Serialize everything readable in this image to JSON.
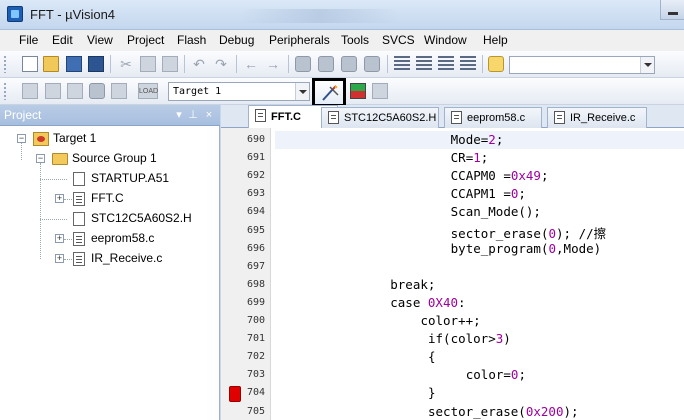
{
  "window": {
    "title": "FFT - µVision4"
  },
  "menu": [
    "File",
    "Edit",
    "View",
    "Project",
    "Flash",
    "Debug",
    "Peripherals",
    "Tools",
    "SVCS",
    "Window",
    "Help"
  ],
  "toolbar": {
    "target_select": "Target 1",
    "options_button_tooltip": "Options for Target..."
  },
  "project": {
    "panel_title": "Project",
    "panel_buttons": [
      "▾",
      "⊥",
      "×"
    ],
    "target": "Target 1",
    "group": "Source Group 1",
    "files": [
      {
        "name": "STARTUP.A51",
        "expandable": false
      },
      {
        "name": "FFT.C",
        "expandable": true
      },
      {
        "name": "STC12C5A60S2.H",
        "expandable": false
      },
      {
        "name": "eeprom58.c",
        "expandable": true
      },
      {
        "name": "IR_Receive.c",
        "expandable": true
      }
    ]
  },
  "tabs": [
    "FFT.C",
    "STC12C5A60S2.H",
    "eeprom58.c",
    "IR_Receive.c"
  ],
  "active_tab": "FFT.C",
  "editor": {
    "lines": [
      {
        "num": "690",
        "indent": 23,
        "pre": "Mode=",
        "lit": "2",
        "post": ";"
      },
      {
        "num": "691",
        "indent": 23,
        "pre": "CR=",
        "lit": "1",
        "post": ";"
      },
      {
        "num": "692",
        "indent": 23,
        "pre": "CCAPM0 =",
        "lit": "0x49",
        "post": ";"
      },
      {
        "num": "693",
        "indent": 23,
        "pre": "CCAPM1 =",
        "lit": "0",
        "post": ";"
      },
      {
        "num": "694",
        "indent": 23,
        "pre": "Scan_Mode();",
        "lit": "",
        "post": ""
      },
      {
        "num": "695",
        "indent": 23,
        "pre": "sector_erase(",
        "lit": "0",
        "post": "); //擦"
      },
      {
        "num": "696",
        "indent": 23,
        "pre": "byte_program(",
        "lit": "0",
        "post": ",Mode)"
      },
      {
        "num": "697",
        "indent": 0,
        "pre": "",
        "lit": "",
        "post": ""
      },
      {
        "num": "698",
        "indent": 15,
        "pre": "break;",
        "lit": "",
        "post": ""
      },
      {
        "num": "699",
        "indent": 15,
        "pre": "case ",
        "lit": "0X40",
        "post": ":"
      },
      {
        "num": "700",
        "indent": 19,
        "pre": "color++;",
        "lit": "",
        "post": ""
      },
      {
        "num": "701",
        "indent": 20,
        "pre": "if(color>",
        "lit": "3",
        "post": ")"
      },
      {
        "num": "702",
        "indent": 20,
        "pre": "{",
        "lit": "",
        "post": ""
      },
      {
        "num": "703",
        "indent": 25,
        "pre": "color=",
        "lit": "0",
        "post": ";"
      },
      {
        "num": "704",
        "indent": 20,
        "pre": "}",
        "lit": "",
        "post": "",
        "breakpoint": true
      },
      {
        "num": "705",
        "indent": 20,
        "pre": "sector_erase(",
        "lit": "0x200",
        "post": ");"
      }
    ]
  },
  "colors": {
    "literal": "#a000a0",
    "breakpoint": "#e00000",
    "panel_header": "#a7bfdf"
  }
}
